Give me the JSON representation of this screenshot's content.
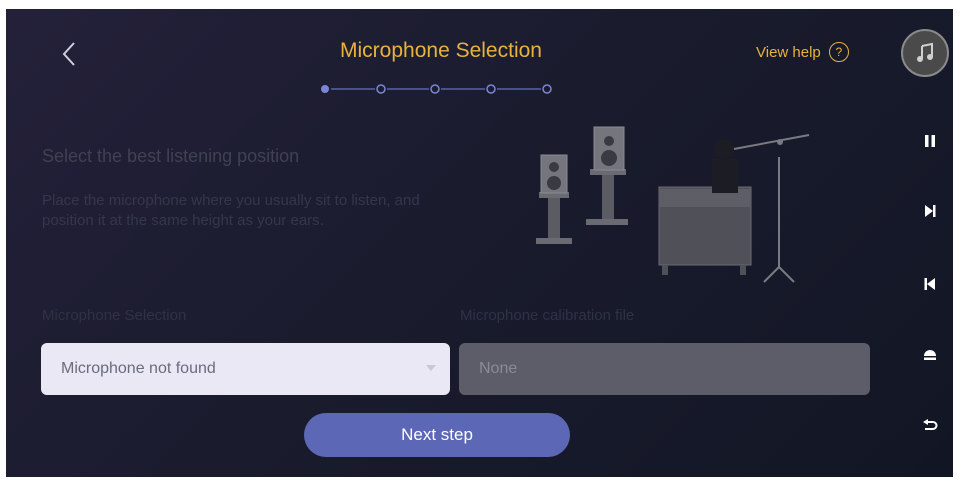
{
  "header": {
    "title": "Microphone Selection",
    "back_icon": "chevron-left-icon",
    "help_label": "View help",
    "help_icon_glyph": "?",
    "steps_total": 5,
    "current_step": 1
  },
  "content": {
    "heading": "Select the best listening position",
    "description": "Place the microphone where you usually sit to listen, and position it at the same height as your ears."
  },
  "form": {
    "mic_label": "Microphone Selection",
    "mic_value": "Microphone not found",
    "calibration_label": "Microphone calibration file",
    "calibration_value": "None"
  },
  "actions": {
    "next_label": "Next step"
  },
  "sidebar": {
    "avatar_icon": "music-note-icon",
    "buttons": [
      "pause-icon",
      "skip-next-icon",
      "skip-previous-icon",
      "eject-icon",
      "return-icon"
    ]
  },
  "colors": {
    "accent": "#e9b23c",
    "button": "#5c68b6",
    "background": "#1a1c2e"
  }
}
